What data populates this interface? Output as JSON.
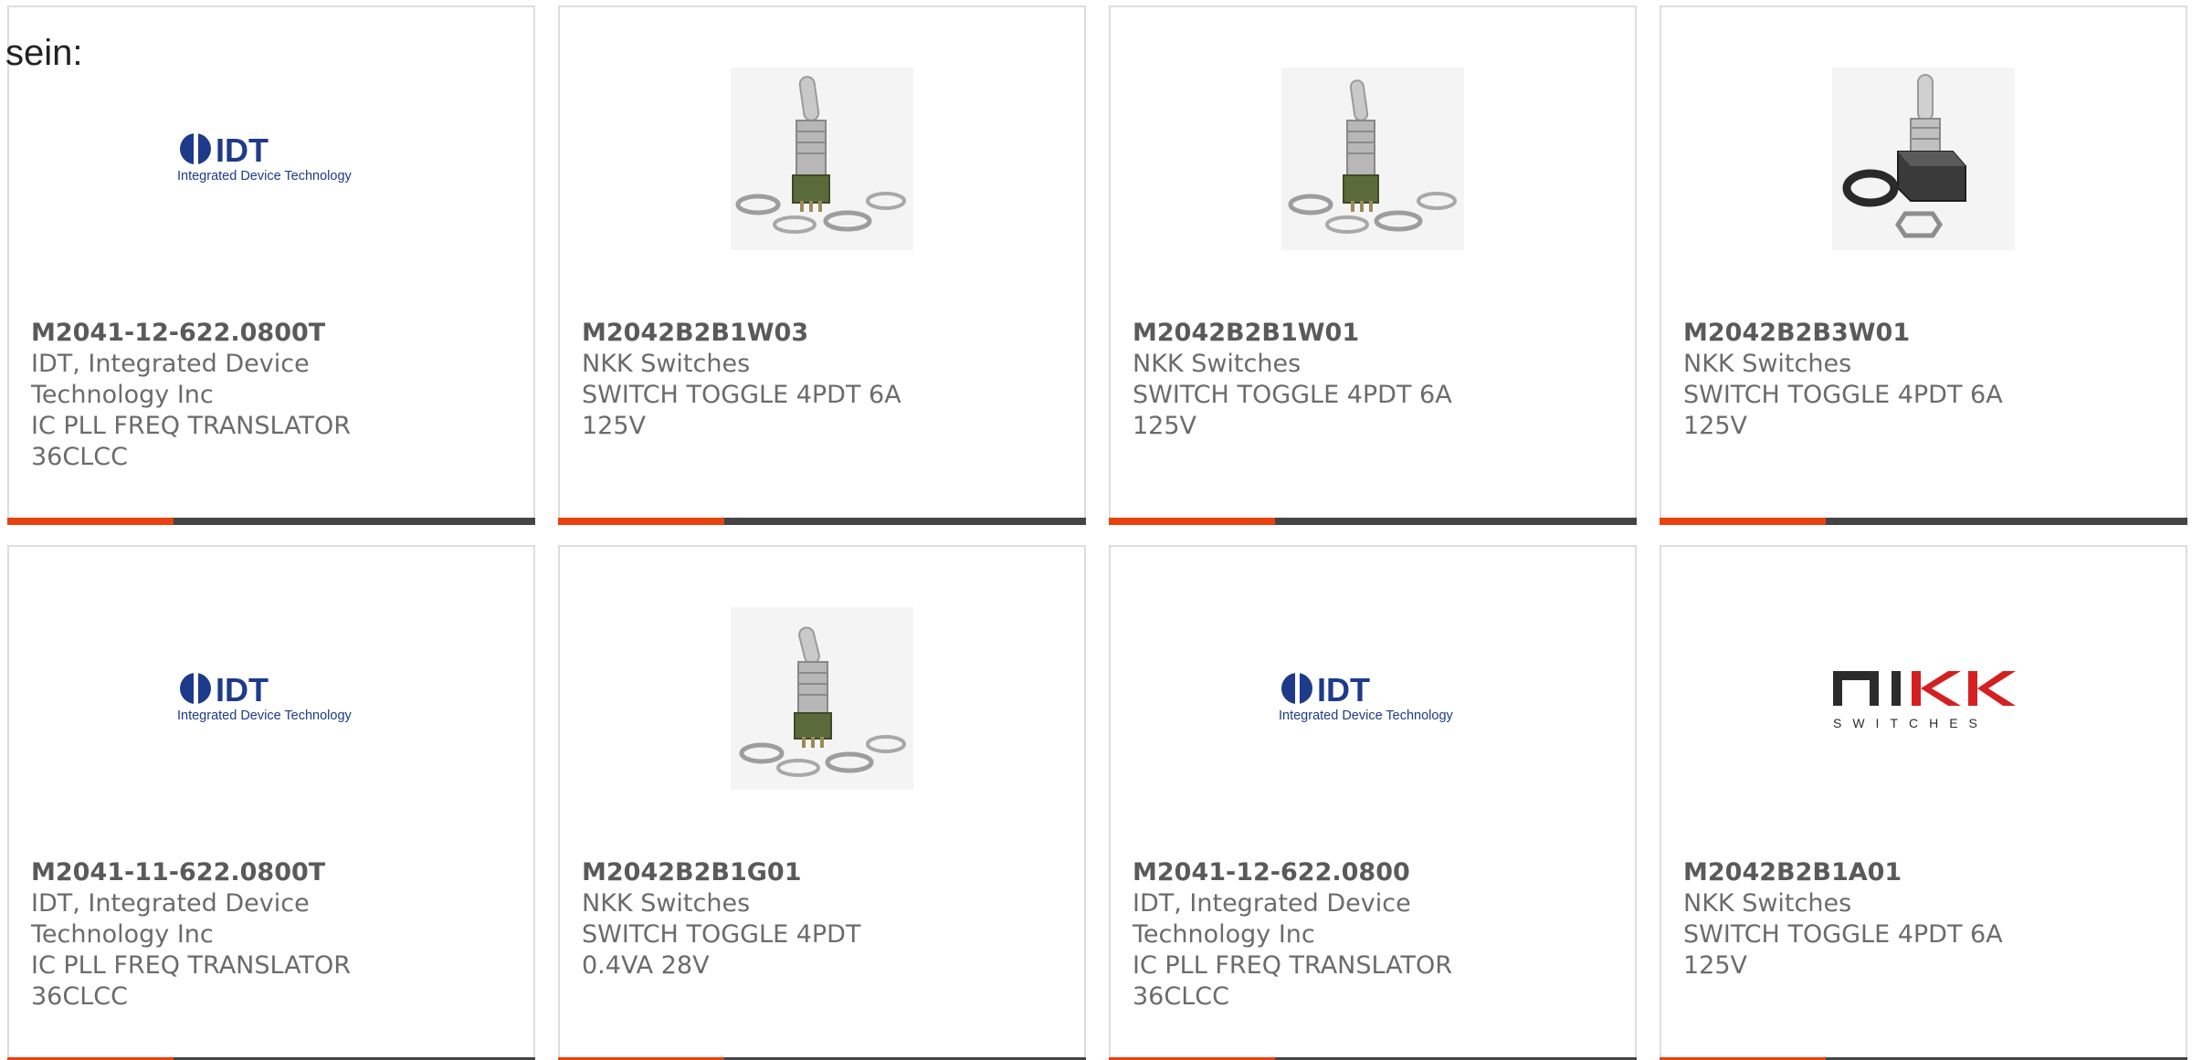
{
  "lead_text": "sein:",
  "colors": {
    "accent_orange": "#e8420e",
    "accent_dark": "#444444",
    "idt_blue": "#1e3a8a",
    "nkk_dark": "#2b2b2b",
    "nkk_red": "#d42020"
  },
  "products": [
    {
      "part": "M2041-12-622.0800T",
      "manufacturer": "IDT, Integrated Device Technology Inc",
      "description": "IC PLL FREQ TRANSLATOR 36CLCC",
      "image": "idt-logo",
      "logo_brand": "IDT",
      "logo_sub": "Integrated Device Technology"
    },
    {
      "part": "M2042B2B1W03",
      "manufacturer": "NKK Switches",
      "description": "SWITCH TOGGLE 4PDT 6A 125V",
      "image": "toggle-switch-photo"
    },
    {
      "part": "M2042B2B1W01",
      "manufacturer": "NKK Switches",
      "description": "SWITCH TOGGLE 4PDT 6A 125V",
      "image": "toggle-switch-photo"
    },
    {
      "part": "M2042B2B3W01",
      "manufacturer": "NKK Switches",
      "description": "SWITCH TOGGLE 4PDT 6A 125V",
      "image": "toggle-switch-black-photo"
    },
    {
      "part": "M2041-11-622.0800T",
      "manufacturer": "IDT, Integrated Device Technology Inc",
      "description": "IC PLL FREQ TRANSLATOR 36CLCC",
      "image": "idt-logo",
      "logo_brand": "IDT",
      "logo_sub": "Integrated Device Technology"
    },
    {
      "part": "M2042B2B1G01",
      "manufacturer": "NKK Switches",
      "description": "SWITCH TOGGLE 4PDT 0.4VA 28V",
      "image": "toggle-switch-photo"
    },
    {
      "part": "M2041-12-622.0800",
      "manufacturer": "IDT, Integrated Device Technology Inc",
      "description": "IC PLL FREQ TRANSLATOR 36CLCC",
      "image": "idt-logo",
      "logo_brand": "IDT",
      "logo_sub": "Integrated Device Technology"
    },
    {
      "part": "M2042B2B1A01",
      "manufacturer": "NKK Switches",
      "description": "SWITCH TOGGLE 4PDT 6A 125V",
      "image": "nkk-logo",
      "logo_brand": "NKK",
      "logo_sub": "SWITCHES"
    }
  ]
}
